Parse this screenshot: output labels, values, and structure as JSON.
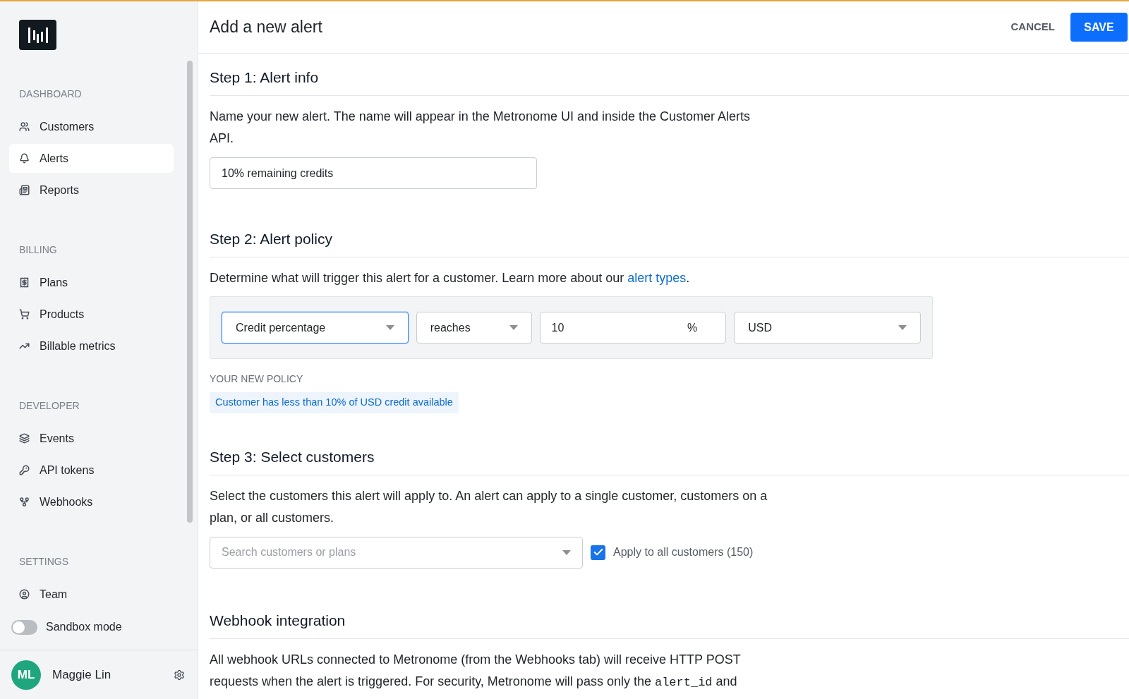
{
  "sidebar": {
    "sections": [
      {
        "title": "DASHBOARD",
        "items": [
          {
            "label": "Customers",
            "selected": false
          },
          {
            "label": "Alerts",
            "selected": true
          },
          {
            "label": "Reports",
            "selected": false
          }
        ]
      },
      {
        "title": "BILLING",
        "items": [
          {
            "label": "Plans",
            "selected": false
          },
          {
            "label": "Products",
            "selected": false
          },
          {
            "label": "Billable metrics",
            "selected": false
          }
        ]
      },
      {
        "title": "DEVELOPER",
        "items": [
          {
            "label": "Events",
            "selected": false
          },
          {
            "label": "API tokens",
            "selected": false
          },
          {
            "label": "Webhooks",
            "selected": false
          }
        ]
      },
      {
        "title": "SETTINGS",
        "items": [
          {
            "label": "Team",
            "selected": false
          }
        ]
      }
    ],
    "sandbox": {
      "label": "Sandbox mode",
      "on": false
    },
    "user": {
      "initials": "ML",
      "name": "Maggie Lin"
    }
  },
  "header": {
    "title": "Add a new alert",
    "cancel": "CANCEL",
    "save": "SAVE"
  },
  "step1": {
    "title": "Step 1: Alert info",
    "description": "Name your new alert. The name will appear in the Metronome UI and inside the Customer Alerts API.",
    "name_value": "10% remaining credits"
  },
  "step2": {
    "title": "Step 2: Alert policy",
    "description": "Determine what will trigger this alert for a customer. Learn more about our ",
    "link": "alert types",
    "after_link": ".",
    "fields": [
      {
        "kind": "select",
        "value": "Credit percentage",
        "focused": true
      },
      {
        "kind": "select",
        "value": "reaches",
        "focused": false
      },
      {
        "kind": "number",
        "value": "10",
        "suffix": "%",
        "focused": false
      },
      {
        "kind": "select",
        "value": "USD",
        "focused": false
      }
    ],
    "policy_label": "YOUR NEW POLICY",
    "policy": "Customer has less than 10% of USD credit available"
  },
  "step3": {
    "title": "Step 3: Select customers",
    "description": "Select the customers this alert will apply to. An alert can apply to a single customer, customers on a plan, or all customers.",
    "search_placeholder": "Search customers or plans",
    "apply_all": {
      "label": "Apply to all customers (150)",
      "checked": true
    }
  },
  "webhook": {
    "title": "Webhook integration",
    "description": "All webhook URLs connected to Metronome (from the Webhooks tab) will receive HTTP POST requests when the alert is triggered. For security, Metronome will pass only the ",
    "code": "alert_id",
    "after_code": " and"
  }
}
